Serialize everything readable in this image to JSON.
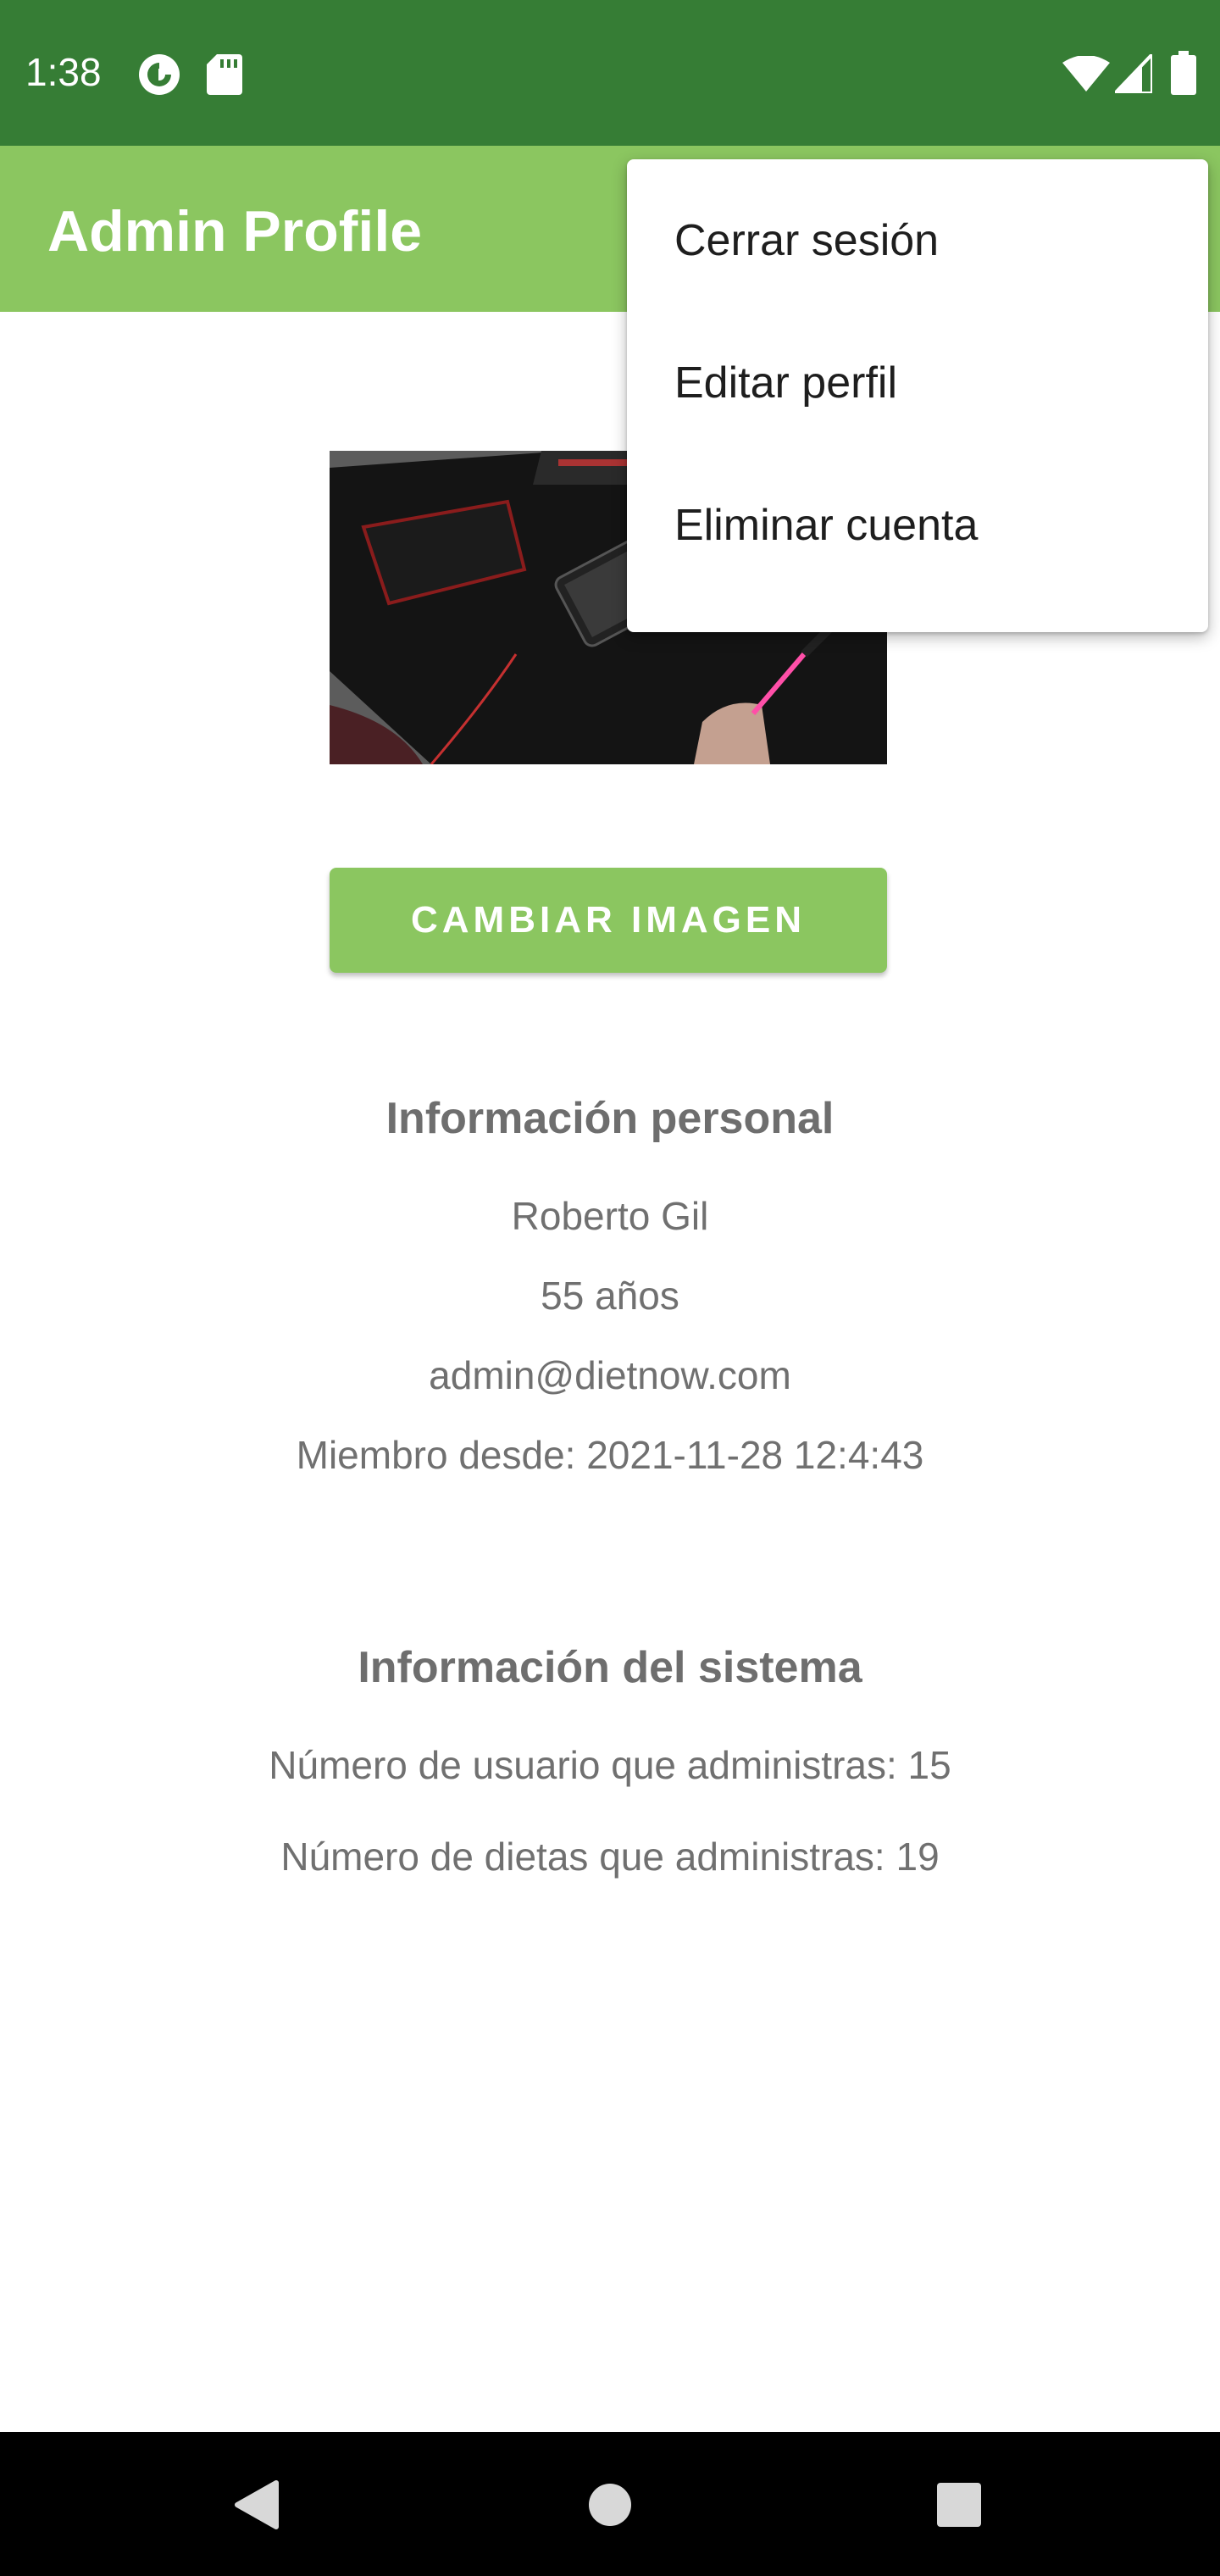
{
  "status_bar": {
    "time": "1:38",
    "icons": [
      "pocket-casts-icon",
      "sd-card-icon",
      "wifi-icon",
      "signal-icon",
      "battery-icon"
    ]
  },
  "app_bar": {
    "title": "Admin Profile"
  },
  "profile": {
    "image_alt": "profile photo: phone charging on desk mat",
    "change_image_button": "CAMBIAR IMAGEN"
  },
  "personal_info": {
    "title": "Información personal",
    "name": "Roberto Gil",
    "age": "55 años",
    "email": "admin@dietnow.com",
    "member_since": "Miembro desde: 2021-11-28 12:4:43"
  },
  "system_info": {
    "title": "Información del sistema",
    "users_count": "Número de usuario que administras: 15",
    "diets_count": "Número de dietas que administras: 19"
  },
  "overflow_menu": {
    "items": [
      {
        "label": "Cerrar sesión"
      },
      {
        "label": "Editar perfil"
      },
      {
        "label": "Eliminar cuenta"
      }
    ]
  },
  "nav_bar": {
    "icons": [
      "back-icon",
      "home-icon",
      "recents-icon"
    ]
  },
  "colors": {
    "status_bar": "#367d35",
    "accent": "#8bc660",
    "text_gray": "#707070"
  }
}
